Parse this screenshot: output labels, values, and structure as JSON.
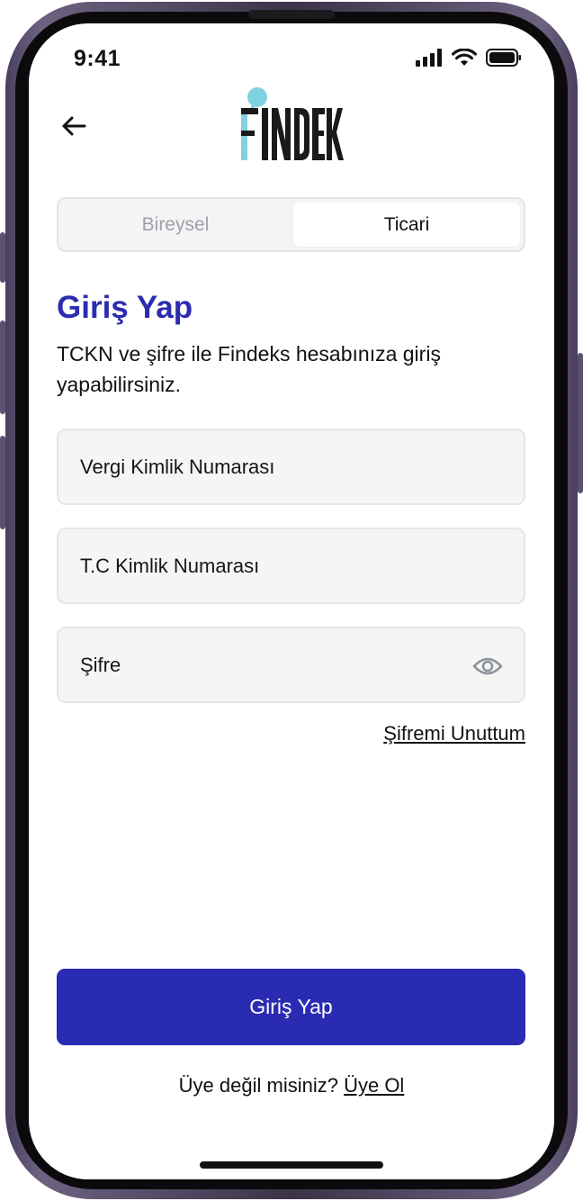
{
  "status_bar": {
    "time": "9:41",
    "icons": [
      "signal-icon",
      "wifi-icon",
      "battery-icon"
    ]
  },
  "header": {
    "back_icon": "arrow-left-icon",
    "logo_text": "FINDEKS",
    "logo_colors": {
      "accent": "#7fd3e0",
      "text": "#1a1a1a"
    }
  },
  "tabs": [
    {
      "label": "Bireysel",
      "selected": false
    },
    {
      "label": "Ticari",
      "selected": true
    }
  ],
  "main": {
    "title": "Giriş Yap",
    "description": "TCKN ve şifre ile Findeks hesabınıza giriş yapabilirsiniz."
  },
  "form": {
    "vkn_placeholder": "Vergi Kimlik Numarası",
    "tckn_placeholder": "T.C Kimlik Numarası",
    "password_placeholder": "Şifre",
    "password_toggle_icon": "eye-icon",
    "forgot_label": "Şifremi Unuttum",
    "submit_label": "Giriş Yap"
  },
  "footer": {
    "question": "Üye değil misiniz?",
    "signup_label": "Üye Ol"
  },
  "colors": {
    "primary": "#2a2bb3",
    "title": "#2b2cb0",
    "input_bg": "#f5f5f5",
    "tab_inactive_text": "#9ea0ab"
  }
}
